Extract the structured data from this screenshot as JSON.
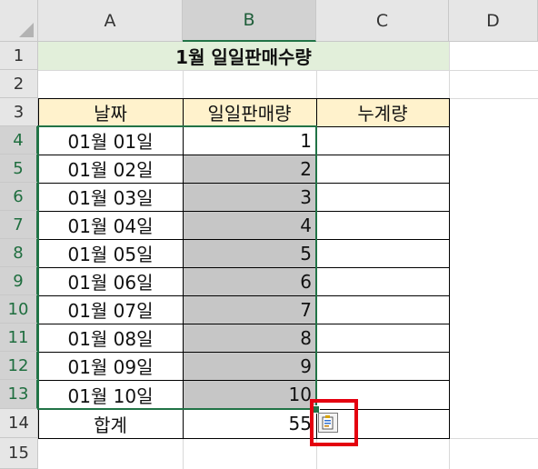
{
  "columns": [
    "A",
    "B",
    "C",
    "D"
  ],
  "rows": [
    "1",
    "2",
    "3",
    "4",
    "5",
    "6",
    "7",
    "8",
    "9",
    "10",
    "11",
    "12",
    "13",
    "14",
    "15"
  ],
  "title": "1월 일일판매수량",
  "headers": {
    "date": "날짜",
    "daily": "일일판매량",
    "cumulative": "누계량"
  },
  "records": [
    {
      "date": "01월 01일",
      "qty": "1"
    },
    {
      "date": "01월 02일",
      "qty": "2"
    },
    {
      "date": "01월 03일",
      "qty": "3"
    },
    {
      "date": "01월 04일",
      "qty": "4"
    },
    {
      "date": "01월 05일",
      "qty": "5"
    },
    {
      "date": "01월 06일",
      "qty": "6"
    },
    {
      "date": "01월 07일",
      "qty": "7"
    },
    {
      "date": "01월 08일",
      "qty": "8"
    },
    {
      "date": "01월 09일",
      "qty": "9"
    },
    {
      "date": "01월 10일",
      "qty": "10"
    }
  ],
  "total": {
    "label": "합계",
    "value": "55"
  },
  "paste_options_icon": "paste-options-icon",
  "colors": {
    "selection": "#217346",
    "highlight": "#e4000f",
    "title_fill": "#e2efda",
    "header_fill": "#fff2cc",
    "selected_fill": "#c6c6c6"
  }
}
